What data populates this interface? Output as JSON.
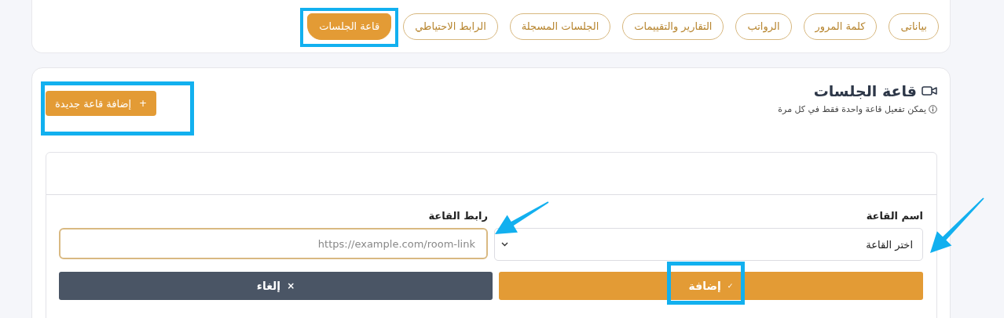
{
  "tabs": [
    {
      "label": "بياناتى",
      "selected": false
    },
    {
      "label": "كلمة المرور",
      "selected": false
    },
    {
      "label": "الرواتب",
      "selected": false
    },
    {
      "label": "التقارير والتقييمات",
      "selected": false
    },
    {
      "label": "الجلسات المسجلة",
      "selected": false
    },
    {
      "label": "الرابط الاحتياطي",
      "selected": false
    },
    {
      "label": "قاعة الجلسات",
      "selected": true
    }
  ],
  "section": {
    "title": "قاعة الجلسات",
    "note": "يمكن تفعيل قاعة واحدة فقط في كل مرة",
    "add_button": {
      "icon": "+",
      "label": "إضافة قاعة جديدة"
    }
  },
  "form": {
    "room_name": {
      "label": "اسم القاعة",
      "value": "اختر القاعة"
    },
    "room_link": {
      "label": "رابط القاعة",
      "placeholder": "https://example.com/room-link"
    },
    "submit": {
      "icon": "✓",
      "label": "إضافة"
    },
    "cancel": {
      "icon": "×",
      "label": "إلغاء"
    }
  }
}
